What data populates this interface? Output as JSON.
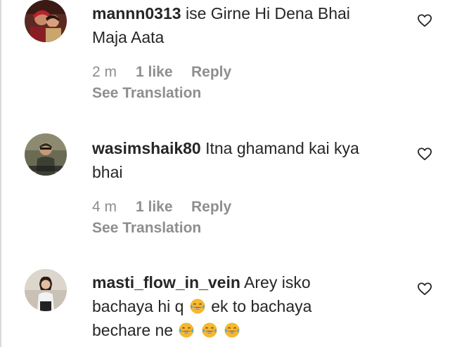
{
  "comments": [
    {
      "username": "mannn0313",
      "text_parts": [
        "ise Girne Hi Dena Bhai Maja Aata"
      ],
      "time": "2 m",
      "likes": "1 like",
      "reply": "Reply",
      "translation": "See Translation"
    },
    {
      "username": "wasimshaik80",
      "text_parts": [
        "Itna ghamand kai kya bhai"
      ],
      "time": "4 m",
      "likes": "1 like",
      "reply": "Reply",
      "translation": "See Translation"
    },
    {
      "username": "masti_flow_in_vein",
      "text_parts": [
        "Arey isko bachaya hi q",
        "ek to bachaya bechare ne"
      ],
      "emoji": "face-with-tears-of-joy-icon"
    }
  ],
  "colors": {
    "text": "#262626",
    "secondary": "#8e8e8e",
    "emoji_yellow": "#f5b82e",
    "emoji_tear": "#4aa8e8"
  }
}
